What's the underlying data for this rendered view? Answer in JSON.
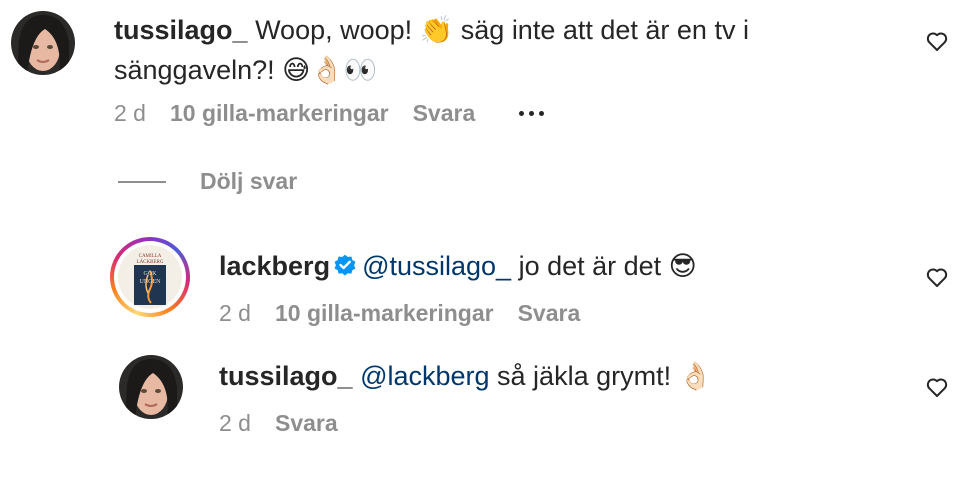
{
  "comments": [
    {
      "username": "tussilago_",
      "text": "Woop, woop! 👏 säg inte att det är en tv i sänggaveln?! 😅👌🏻👀",
      "time": "2 d",
      "likes": "10 gilla-markeringar",
      "reply_label": "Svara",
      "more_icon": "ellipsis-icon"
    }
  ],
  "hide_replies_label": "Dölj svar",
  "replies": [
    {
      "username": "lackberg",
      "verified": true,
      "mention": "@tussilago_",
      "text": " jo det är det 😎",
      "time": "2 d",
      "likes": "10 gilla-markeringar",
      "reply_label": "Svara",
      "avatar_book_lines": [
        "CAMILLA",
        "LÄCKBERG",
        "GÖK",
        "UNGEN"
      ]
    },
    {
      "username": "tussilago_",
      "mention": "@lackberg",
      "text": " så jäkla grymt! 👌🏻",
      "time": "2 d",
      "reply_label": "Svara"
    }
  ],
  "colors": {
    "text": "#262626",
    "muted": "#8e8e8e",
    "mention": "#00376b",
    "verified": "#0095f6"
  }
}
